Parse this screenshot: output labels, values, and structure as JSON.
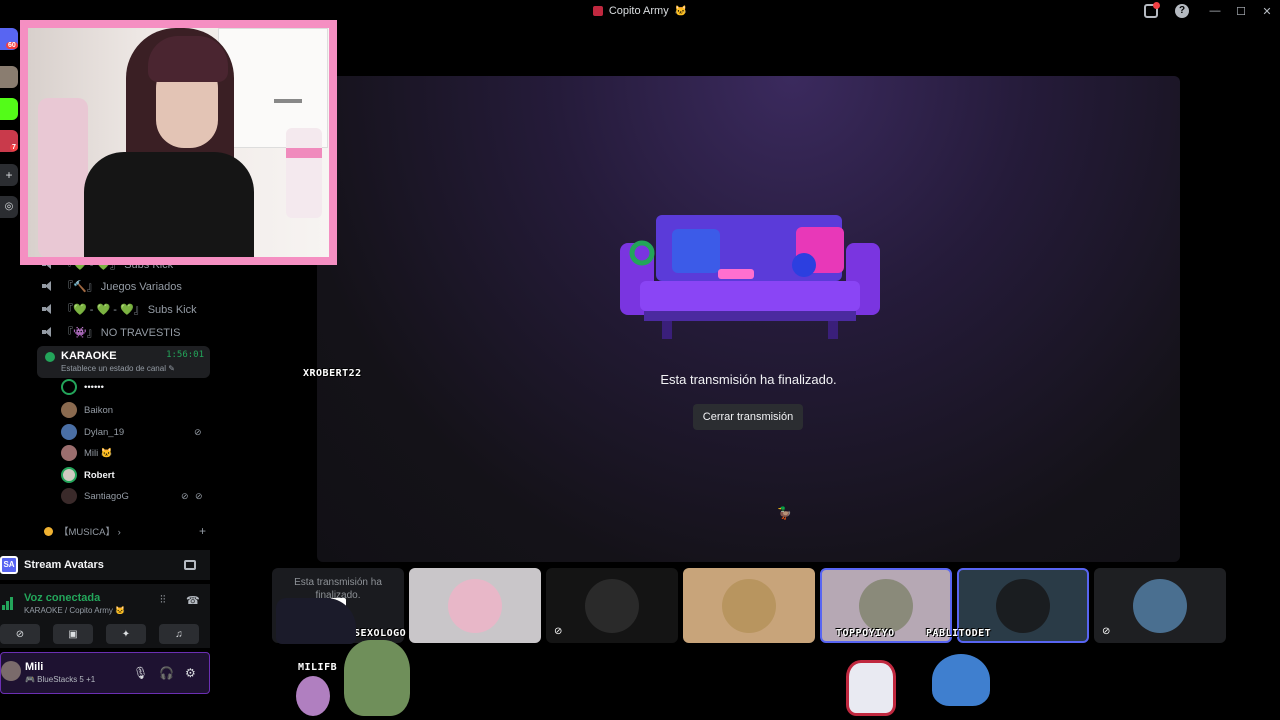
{
  "window": {
    "title": "Copito Army",
    "title_emoji": "🐱",
    "controls": [
      "—",
      "☐",
      "✕"
    ]
  },
  "rail": {
    "badges": [
      "60",
      "7"
    ]
  },
  "channels": {
    "items": [
      {
        "label": "『💚 - 💚』 Subs Kick"
      },
      {
        "label": "『🔨』 Juegos Variados"
      },
      {
        "label": "『💚 - 💚 - 💚』 Subs Kick"
      },
      {
        "label": "『👾』 NO TRAVESTIS"
      }
    ],
    "active": {
      "label": "KARAOKE",
      "time": "1:56:01",
      "status": "Establece un estado de canal ✎"
    },
    "members": [
      {
        "name": "••••••"
      },
      {
        "name": "Baikon"
      },
      {
        "name": "Dylan_19"
      },
      {
        "name": "Mili 🐱"
      },
      {
        "name": "Robert"
      },
      {
        "name": "SantiagoG"
      }
    ],
    "music": {
      "label": "【MUSICA】 ›",
      "plus": "+"
    }
  },
  "stream_avatars": {
    "label": "Stream Avatars",
    "logo": "SA"
  },
  "voice": {
    "status": "Voz conectada",
    "location": "KARAOKE / Copito Army 🐱"
  },
  "user": {
    "name": "Mili",
    "activity": "🎮 BlueStacks 5 +1"
  },
  "stream": {
    "ended_text": "Esta transmisión ha finalizado.",
    "close_label": "Cerrar transmisión",
    "overlay_name": "XROBERT22"
  },
  "tiles": {
    "ended_text": "Esta transmisión ha finalizado.",
    "names": [
      "SEXOLOGO",
      "TOPPOYIYO",
      "PABLITODET",
      "MILIFB"
    ]
  },
  "colors": {
    "accent": "#5865f2",
    "online": "#23a55a",
    "webcam_border": "#f58fc2",
    "user_panel_border": "#6b2fb3"
  }
}
